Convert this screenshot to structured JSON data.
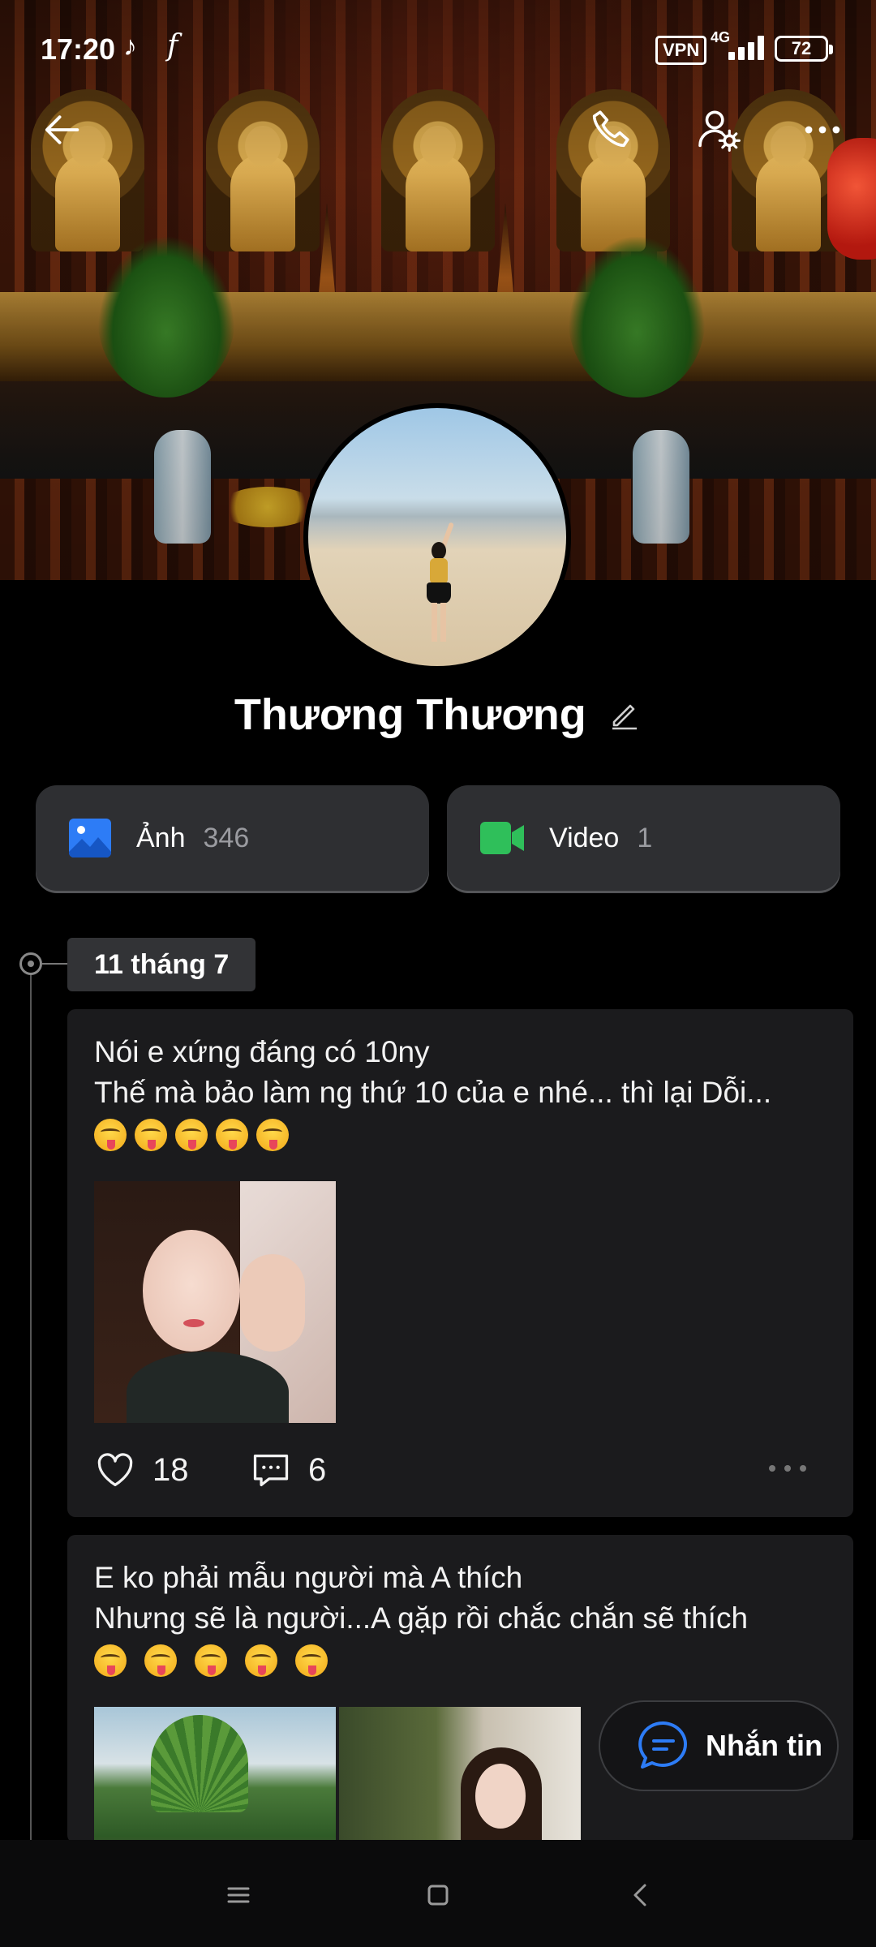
{
  "status_bar": {
    "time": "17:20",
    "vpn_label": "VPN",
    "network": "4G",
    "battery": "72",
    "icons": [
      "tiktok-icon",
      "facebook-icon",
      "signal-icon",
      "battery-icon"
    ]
  },
  "header": {
    "icons": [
      "back-arrow-icon",
      "phone-call-icon",
      "user-settings-icon",
      "more-options-icon"
    ]
  },
  "profile": {
    "name": "Thương Thương",
    "edit_icon": "pencil-icon"
  },
  "media": {
    "photos": {
      "label": "Ảnh",
      "count": "346",
      "icon": "image-icon",
      "icon_color": "#2d7cf6"
    },
    "videos": {
      "label": "Video",
      "count": "1",
      "icon": "video-camera-icon",
      "icon_color": "#2fbf5a"
    }
  },
  "timeline": {
    "date": "11 tháng 7"
  },
  "posts": [
    {
      "line1": "Nói e xứng đáng có 10ny",
      "line2": "Thế mà bảo làm ng thứ 10 của e nhé... thì lại Dỗi...",
      "emoji_count": 5,
      "emoji_name": "squinting-face-with-tongue",
      "likes": "18",
      "comments": "6"
    },
    {
      "line1": "E ko phải mẫu người mà A thích",
      "line2": "Nhưng sẽ là người...A gặp rồi chắc chắn sẽ thích",
      "emoji_count": 5,
      "emoji_name": "squinting-face-with-tongue"
    }
  ],
  "chat_button": {
    "label": "Nhắn tin",
    "icon": "chat-bubble-icon",
    "icon_color": "#2d7cf6"
  },
  "system_nav": {
    "icons": [
      "menu-icon",
      "home-icon",
      "back-icon"
    ]
  }
}
